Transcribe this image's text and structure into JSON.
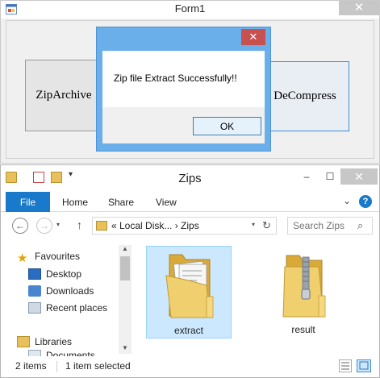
{
  "form1": {
    "title": "Form1",
    "close_glyph": "✕",
    "archive_button_label": "ZipArchive",
    "decompress_button_label": "DeCompress"
  },
  "message_box": {
    "close_glyph": "✕",
    "text": "Zip file Extract Successfully!!",
    "ok_label": "OK"
  },
  "explorer": {
    "title": "Zips",
    "minimize_glyph": "‒",
    "maximize_glyph": "☐",
    "close_glyph": "✕",
    "ribbon": {
      "tabs": [
        {
          "label": "File"
        },
        {
          "label": "Home"
        },
        {
          "label": "Share"
        },
        {
          "label": "View"
        }
      ],
      "help_glyph": "?"
    },
    "nav": {
      "back_glyph": "←",
      "forward_glyph": "→",
      "up_glyph": "↑",
      "address_path": "« Local Disk... › Zips",
      "search_placeholder": "Search Zips"
    },
    "nav_pane": {
      "favourites": "Favourites",
      "desktop": "Desktop",
      "downloads": "Downloads",
      "recent": "Recent places",
      "libraries": "Libraries",
      "partial_item": "Documents"
    },
    "files": [
      {
        "name": "extract",
        "kind": "folder",
        "selected": true
      },
      {
        "name": "result",
        "kind": "zip",
        "selected": false
      }
    ],
    "status": {
      "count": "2 items",
      "selected": "1 item selected"
    }
  },
  "colors": {
    "accent": "#1979ca",
    "selection": "#cce8ff",
    "msg_border": "#6aaeea",
    "msg_close": "#c75050"
  },
  "icons": {
    "app": "form-icon",
    "favourites": "star-icon",
    "desktop": "desktop-icon",
    "downloads": "downloads-icon",
    "recent": "recent-places-icon",
    "libraries": "libraries-icon",
    "folder": "folder-icon",
    "zip": "zip-folder-icon",
    "search": "search-icon",
    "refresh": "refresh-icon"
  }
}
